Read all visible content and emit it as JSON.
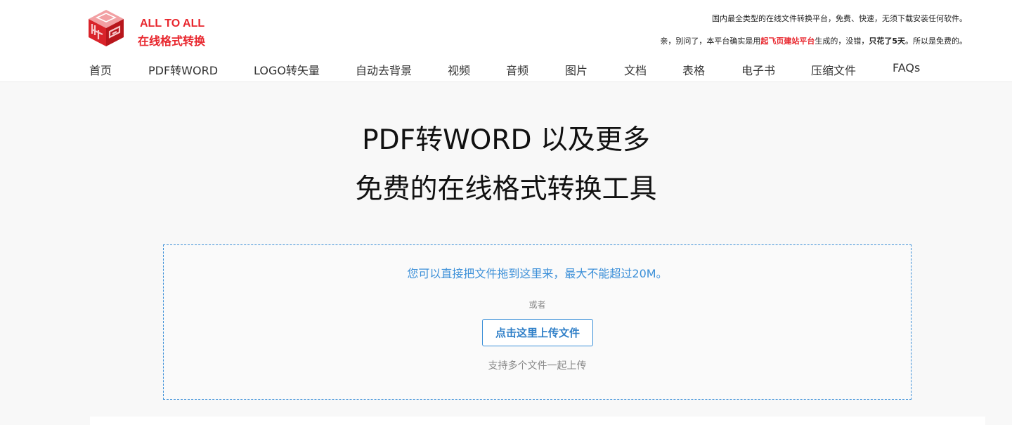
{
  "brand": {
    "name_en": "ALL TO ALL",
    "name_cn": "在线格式转换",
    "accent": "#e8262d"
  },
  "header": {
    "tagline": "国内最全类型的在线文件转换平台，免费、快速，无须下载安装任何软件。",
    "note": {
      "part1": "亲，别问了，本平台确实是用",
      "link": "起飞页建站平台",
      "part2": "生成的，没错，",
      "bold": "只花了5天",
      "part3": "。所以是免费的。"
    }
  },
  "nav": {
    "items": [
      {
        "label": "首页"
      },
      {
        "label": "PDF转WORD"
      },
      {
        "label": "LOGO转矢量"
      },
      {
        "label": "自动去背景"
      },
      {
        "label": "视频"
      },
      {
        "label": "音频"
      },
      {
        "label": "图片"
      },
      {
        "label": "文档"
      },
      {
        "label": "表格"
      },
      {
        "label": "电子书"
      },
      {
        "label": "压缩文件"
      },
      {
        "label": "FAQs"
      }
    ]
  },
  "hero": {
    "line1": "PDF转WORD 以及更多",
    "line2": "免费的在线格式转换工具"
  },
  "upload": {
    "drop_hint": "您可以直接把文件拖到这里来，最大不能超过20M。",
    "or": "或者",
    "button_label": "点击这里上传文件",
    "multi_hint": "支持多个文件一起上传",
    "accent": "#3b8fd8"
  }
}
